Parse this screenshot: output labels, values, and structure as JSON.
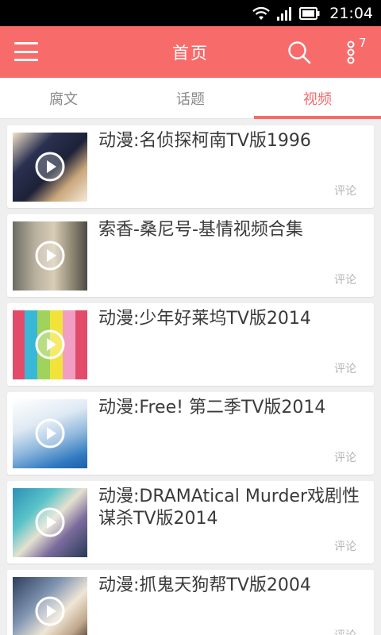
{
  "status_bar": {
    "time": "21:04",
    "icons": [
      "wifi-icon",
      "signal-icon",
      "battery-icon"
    ]
  },
  "header": {
    "title": "首页",
    "menu_icon": "hamburger-menu-icon",
    "search_icon": "search-icon",
    "more_icon": "vertical-dots-icon",
    "notification_count": "7",
    "accent_color": "#f86b6b"
  },
  "tabs": [
    {
      "label": "腐文",
      "active": false
    },
    {
      "label": "话题",
      "active": false
    },
    {
      "label": "视频",
      "active": true
    }
  ],
  "videos": [
    {
      "title": "动漫:名侦探柯南TV版1996",
      "comment_label": "评论"
    },
    {
      "title": "索香-桑尼号-基情视频合集",
      "comment_label": "评论"
    },
    {
      "title": "动漫:少年好莱坞TV版2014",
      "comment_label": "评论"
    },
    {
      "title": "动漫:Free! 第二季TV版2014",
      "comment_label": "评论"
    },
    {
      "title": "动漫:DRAMAtical Murder戏剧性谋杀TV版2014",
      "comment_label": "评论"
    },
    {
      "title": "动漫:抓鬼天狗帮TV版2004",
      "comment_label": "评论"
    }
  ]
}
